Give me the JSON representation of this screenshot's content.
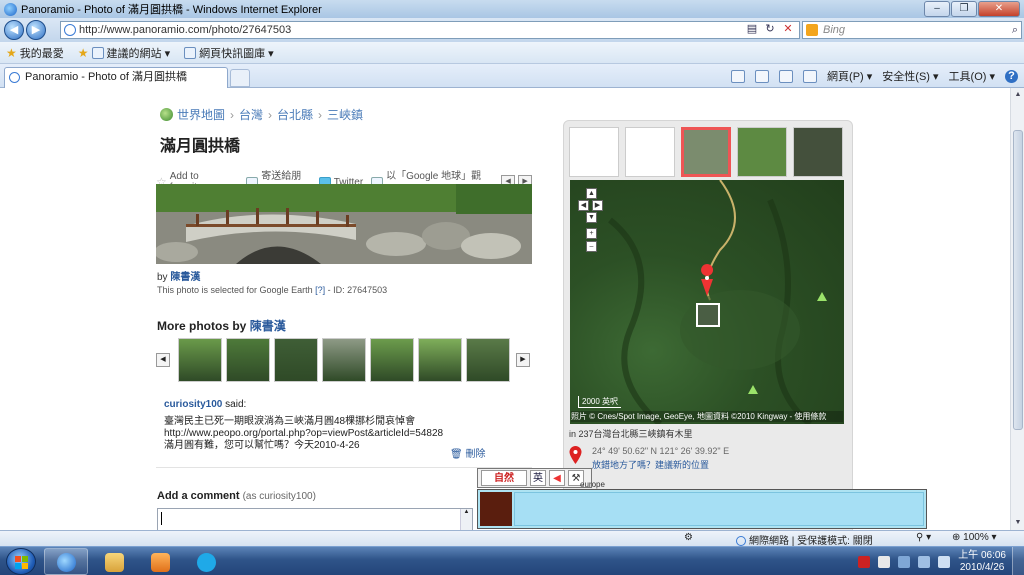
{
  "window": {
    "title": "Panoramio - Photo of 滿月圓拱橋 - Windows Internet Explorer",
    "min_label": "–",
    "restore_label": "❐",
    "close_label": "✕"
  },
  "address": {
    "url": "http://www.panoramio.com/photo/27647503",
    "search_placeholder": "Bing"
  },
  "favorites": {
    "label": "我的最愛",
    "items": [
      "建議的網站 ▾",
      "網頁快訊圖庫 ▾"
    ]
  },
  "tab": {
    "label": "Panoramio - Photo of 滿月圓拱橋"
  },
  "commands": {
    "page": "網頁(P) ▾",
    "safety": "安全性(S) ▾",
    "tools": "工具(O) ▾",
    "help": "?"
  },
  "breadcrumb": [
    "世界地圖",
    "台灣",
    "台北縣",
    "三峽鎮"
  ],
  "photo": {
    "title": "滿月圓拱橋",
    "add_favorites": "Add to favorites",
    "send_friend": "寄送給朋友",
    "twitter": "Twitter",
    "google_earth": "以「Google 地球」觀看",
    "by_prefix": "by",
    "author": "陳書漢",
    "selected_text": "This photo is selected for Google Earth",
    "selected_link": "[?]",
    "selected_id": "- ID: 27647503"
  },
  "more_photos": {
    "prefix": "More photos by",
    "author": "陳書漢",
    "thumbs": [
      "#6a9a4a",
      "#4e7a3a",
      "#3f5e36",
      "#8e9a86",
      "#6c9c4c",
      "#7fae5a",
      "#5a7a48"
    ]
  },
  "comment": {
    "user": "curiosity100",
    "said": "said:",
    "line1": "臺灣民主已死一期眼淚淌為三峽滿月圓48棵挪杉閒哀悼會",
    "line2": "http://www.peopo.org/portal.php?op=viewPost&articleId=54828",
    "line3": "滿月圓有難，您可以幫忙嗎？今天2010-4-26",
    "delete": "刪除"
  },
  "add_comment": {
    "title": "Add a comment",
    "as": "(as curiosity100)"
  },
  "map": {
    "scale": "2000 英呎",
    "copyright": "照片 © Cnes/Spot Image, GeoEye, 地圖資料 ©2010 Kingway - 使用條款",
    "location": "in 237台灣台北縣三峽鎮有木里",
    "coords": "24° 49' 50.62\" N  121° 26' 39.92\" E",
    "wrong_place": "放錯地方了嗎？建議新的位置",
    "thumbs": [
      "#ffffff",
      "#ffffff",
      "#7b8c6e",
      "#5d8a42",
      "#44503c"
    ]
  },
  "ime": {
    "logo": "自然",
    "eng": "英",
    "europe": "europe"
  },
  "status": {
    "zone": "網際網路 | 受保護模式: 關閉",
    "zoom": "100%"
  },
  "taskbar": {
    "time": "上午 06:06",
    "date": "2010/4/26"
  }
}
